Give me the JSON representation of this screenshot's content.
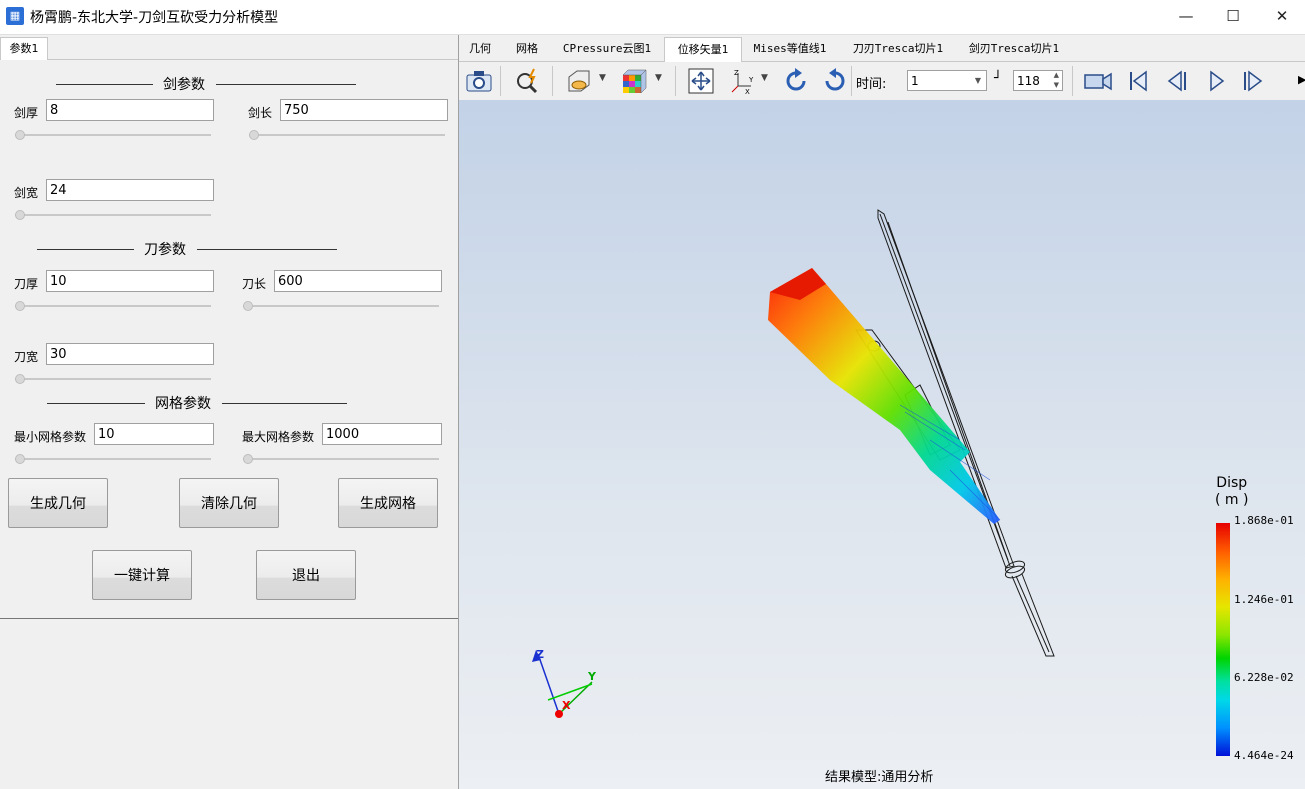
{
  "window": {
    "title": "杨霄鹏-东北大学-刀剑互砍受力分析模型",
    "minimize": "—",
    "maximize": "☐",
    "close": "✕"
  },
  "left": {
    "tab": "参数1",
    "sword_section": "剑参数",
    "blade_section": "刀参数",
    "mesh_section": "网格参数",
    "fields": {
      "sword_thickness": {
        "label": "剑厚",
        "value": "8"
      },
      "sword_length": {
        "label": "剑长",
        "value": "750"
      },
      "sword_width": {
        "label": "剑宽",
        "value": "24"
      },
      "blade_thickness": {
        "label": "刀厚",
        "value": "10"
      },
      "blade_length": {
        "label": "刀长",
        "value": "600"
      },
      "blade_width": {
        "label": "刀宽",
        "value": "30"
      },
      "min_mesh": {
        "label": "最小网格参数",
        "value": "10"
      },
      "max_mesh": {
        "label": "最大网格参数",
        "value": "1000"
      }
    },
    "buttons": {
      "gen_geometry": "生成几何",
      "clear_geometry": "清除几何",
      "gen_mesh": "生成网格",
      "compute": "一键计算",
      "exit": "退出"
    }
  },
  "right": {
    "tabs": [
      "几何",
      "网格",
      "CPressure云图1",
      "位移矢量1",
      "Mises等值线1",
      "刀刃Tresca切片1",
      "剑刃Tresca切片1"
    ],
    "active_tab": 3,
    "toolbar": {
      "time_label": "时间:",
      "time_value": "1",
      "step_value": "118"
    },
    "legend": {
      "title_line1": "Disp",
      "title_line2": "( m )",
      "max": "1.868e-01",
      "v2": "1.246e-01",
      "v3": "6.228e-02",
      "min": "4.464e-24"
    },
    "axes": {
      "z": "Z",
      "y": "Y",
      "x": "X"
    },
    "result_label": "结果模型:通用分析"
  },
  "colors": {
    "accent": "#2b6fd6",
    "viewport_top": "#c3d2e7",
    "viewport_bottom": "#eceff3"
  }
}
